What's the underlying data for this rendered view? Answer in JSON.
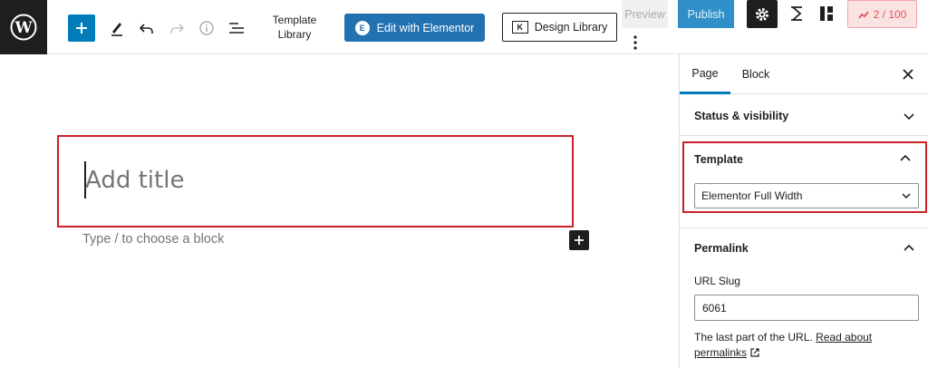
{
  "toolbar": {
    "template_library_label": "Template Library",
    "edit_elementor_label": "Edit with Elementor",
    "design_library_label": "Design Library",
    "preview_label": "Preview",
    "publish_label": "Publish",
    "score_label": "2 / 100"
  },
  "editor": {
    "title_placeholder": "Add title",
    "block_placeholder": "Type / to choose a block"
  },
  "sidebar": {
    "tabs": [
      {
        "label": "Page"
      },
      {
        "label": "Block"
      }
    ],
    "status_visibility_label": "Status & visibility",
    "template": {
      "heading": "Template",
      "selected": "Elementor Full Width"
    },
    "permalink": {
      "heading": "Permalink",
      "url_slug_label": "URL Slug",
      "url_slug_value": "6061",
      "help_text": "The last part of the URL.",
      "read_about_link": "Read about permalinks"
    }
  },
  "colors": {
    "accent": "#007cba",
    "elementor_blue": "#2271b1",
    "highlight_red": "#c92226",
    "dark": "#1e1e1e"
  }
}
